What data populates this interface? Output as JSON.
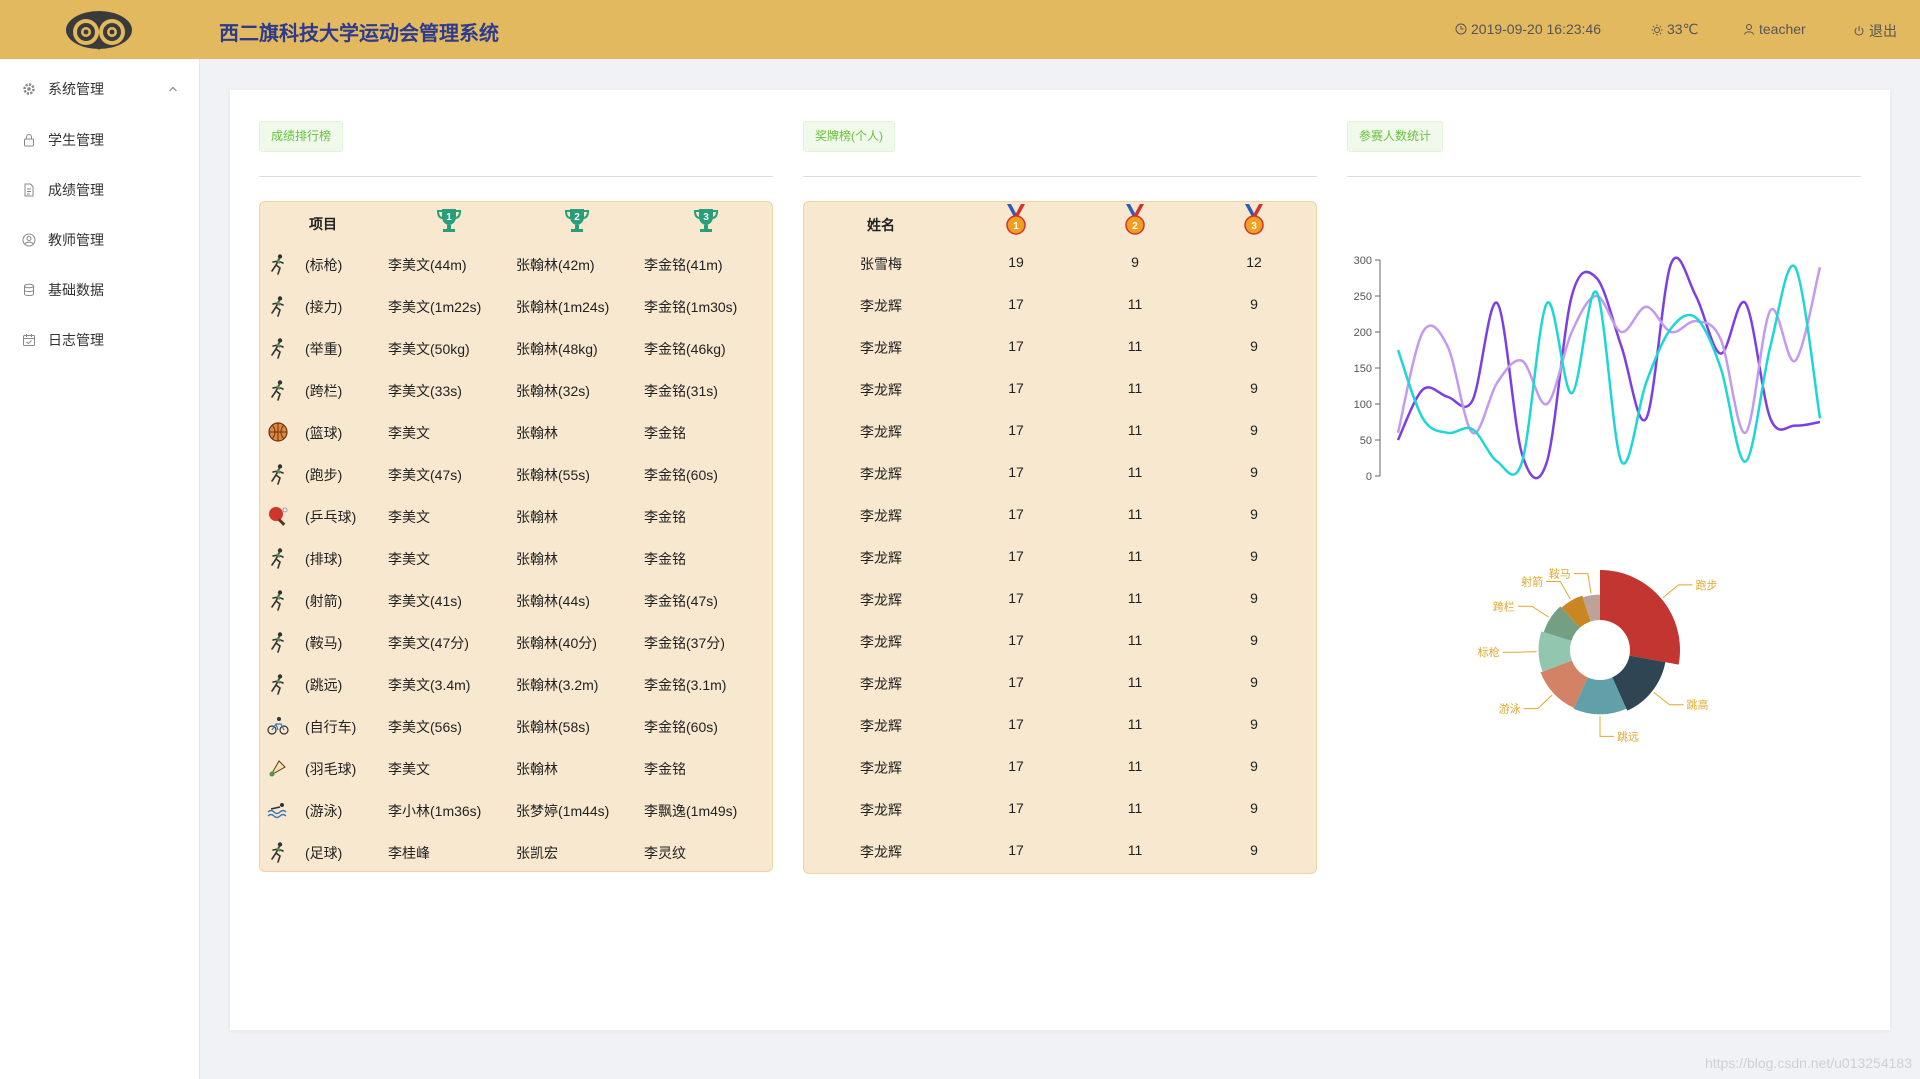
{
  "header": {
    "title": "西二旗科技大学运动会管理系统",
    "datetime": "2019-09-20 16:23:46",
    "temperature": "33℃",
    "user": "teacher",
    "logout": "退出",
    "bg_color": "#e2b95f",
    "title_color": "#2e3a8c"
  },
  "sidebar": {
    "items": [
      {
        "label": "系统管理",
        "icon": "gear-icon"
      },
      {
        "label": "学生管理",
        "icon": "lock-icon"
      },
      {
        "label": "成绩管理",
        "icon": "document-icon"
      },
      {
        "label": "教师管理",
        "icon": "user-circle-icon"
      },
      {
        "label": "基础数据",
        "icon": "database-icon"
      },
      {
        "label": "日志管理",
        "icon": "calendar-icon"
      }
    ]
  },
  "tags": {
    "ranking": "成绩排行榜",
    "medals": "奖牌榜(个人)",
    "participants": "参赛人数统计"
  },
  "ranking": {
    "header_project": "项目",
    "trophy_labels": [
      "1",
      "2",
      "3"
    ],
    "rows": [
      {
        "event": "(标枪)",
        "icon": "javelin-icon",
        "first": "李美文(44m)",
        "second": "张翰林(42m)",
        "third": "李金铭(41m)"
      },
      {
        "event": "(接力)",
        "icon": "relay-icon",
        "first": "李美文(1m22s)",
        "second": "张翰林(1m24s)",
        "third": "李金铭(1m30s)"
      },
      {
        "event": "(举重)",
        "icon": "weightlifting-icon",
        "first": "李美文(50kg)",
        "second": "张翰林(48kg)",
        "third": "李金铭(46kg)"
      },
      {
        "event": "(跨栏)",
        "icon": "hurdles-icon",
        "first": "李美文(33s)",
        "second": "张翰林(32s)",
        "third": "李金铭(31s)"
      },
      {
        "event": "(篮球)",
        "icon": "basketball-icon",
        "first": "李美文",
        "second": "张翰林",
        "third": "李金铭"
      },
      {
        "event": "(跑步)",
        "icon": "running-icon",
        "first": "李美文(47s)",
        "second": "张翰林(55s)",
        "third": "李金铭(60s)"
      },
      {
        "event": "(乒乓球)",
        "icon": "ping-pong-icon",
        "first": "李美文",
        "second": "张翰林",
        "third": "李金铭"
      },
      {
        "event": "(排球)",
        "icon": "volleyball-icon",
        "first": "李美文",
        "second": "张翰林",
        "third": "李金铭"
      },
      {
        "event": "(射箭)",
        "icon": "archery-icon",
        "first": "李美文(41s)",
        "second": "张翰林(44s)",
        "third": "李金铭(47s)"
      },
      {
        "event": "(鞍马)",
        "icon": "pommel-horse-icon",
        "first": "李美文(47分)",
        "second": "张翰林(40分)",
        "third": "李金铭(37分)"
      },
      {
        "event": "(跳远)",
        "icon": "long-jump-icon",
        "first": "李美文(3.4m)",
        "second": "张翰林(3.2m)",
        "third": "李金铭(3.1m)"
      },
      {
        "event": "(自行车)",
        "icon": "cycling-icon",
        "first": "李美文(56s)",
        "second": "张翰林(58s)",
        "third": "李金铭(60s)"
      },
      {
        "event": "(羽毛球)",
        "icon": "badminton-icon",
        "first": "李美文",
        "second": "张翰林",
        "third": "李金铭"
      },
      {
        "event": "(游泳)",
        "icon": "swimming-icon",
        "first": "李小林(1m36s)",
        "second": "张梦婷(1m44s)",
        "third": "李飘逸(1m49s)"
      },
      {
        "event": "(足球)",
        "icon": "soccer-icon",
        "first": "李桂峰",
        "second": "张凯宏",
        "third": "李灵纹"
      }
    ]
  },
  "medals": {
    "header_name": "姓名",
    "medal_labels": [
      "1",
      "2",
      "3"
    ],
    "rows": [
      {
        "name": "张雪梅",
        "gold": "19",
        "silver": "9",
        "bronze": "12"
      },
      {
        "name": "李龙辉",
        "gold": "17",
        "silver": "11",
        "bronze": "9"
      },
      {
        "name": "李龙辉",
        "gold": "17",
        "silver": "11",
        "bronze": "9"
      },
      {
        "name": "李龙辉",
        "gold": "17",
        "silver": "11",
        "bronze": "9"
      },
      {
        "name": "李龙辉",
        "gold": "17",
        "silver": "11",
        "bronze": "9"
      },
      {
        "name": "李龙辉",
        "gold": "17",
        "silver": "11",
        "bronze": "9"
      },
      {
        "name": "李龙辉",
        "gold": "17",
        "silver": "11",
        "bronze": "9"
      },
      {
        "name": "李龙辉",
        "gold": "17",
        "silver": "11",
        "bronze": "9"
      },
      {
        "name": "李龙辉",
        "gold": "17",
        "silver": "11",
        "bronze": "9"
      },
      {
        "name": "李龙辉",
        "gold": "17",
        "silver": "11",
        "bronze": "9"
      },
      {
        "name": "李龙辉",
        "gold": "17",
        "silver": "11",
        "bronze": "9"
      },
      {
        "name": "李龙辉",
        "gold": "17",
        "silver": "11",
        "bronze": "9"
      },
      {
        "name": "李龙辉",
        "gold": "17",
        "silver": "11",
        "bronze": "9"
      },
      {
        "name": "李龙辉",
        "gold": "17",
        "silver": "11",
        "bronze": "9"
      },
      {
        "name": "李龙辉",
        "gold": "17",
        "silver": "11",
        "bronze": "9"
      }
    ]
  },
  "chart_data": [
    {
      "type": "line",
      "title": "",
      "xlabel": "",
      "ylabel": "",
      "ylim": [
        0,
        300
      ],
      "yticks": [
        0,
        50,
        100,
        150,
        200,
        250,
        300
      ],
      "x": [
        0,
        1,
        2,
        3,
        4,
        5,
        6,
        7,
        8,
        9,
        10,
        11,
        12,
        13,
        14,
        15,
        16,
        17
      ],
      "series": [
        {
          "color": "#7b3fe4",
          "values": [
            50,
            120,
            110,
            105,
            240,
            30,
            20,
            250,
            275,
            180,
            80,
            295,
            250,
            170,
            240,
            80,
            70,
            75
          ]
        },
        {
          "color": "#c39af0",
          "values": [
            60,
            200,
            180,
            60,
            130,
            160,
            100,
            200,
            250,
            200,
            235,
            200,
            215,
            190,
            60,
            230,
            160,
            290
          ]
        },
        {
          "color": "#1dd6d6",
          "values": [
            175,
            80,
            60,
            65,
            20,
            20,
            240,
            115,
            255,
            20,
            130,
            205,
            220,
            150,
            20,
            180,
            290,
            80
          ]
        }
      ]
    },
    {
      "type": "pie",
      "style": "rose-donut",
      "categories": [
        "跑步",
        "跳高",
        "跳远",
        "游泳",
        "标枪",
        "跨栏",
        "射箭",
        "鞍马"
      ],
      "values": [
        100,
        55,
        48,
        45,
        38,
        30,
        24,
        18
      ],
      "colors": [
        "#c23531",
        "#2f4554",
        "#61a0a8",
        "#d48265",
        "#91c7ae",
        "#749f83",
        "#ca8622",
        "#bda29a"
      ],
      "label_color": "#e0a830"
    }
  ],
  "watermark": "https://blog.csdn.net/u013254183"
}
